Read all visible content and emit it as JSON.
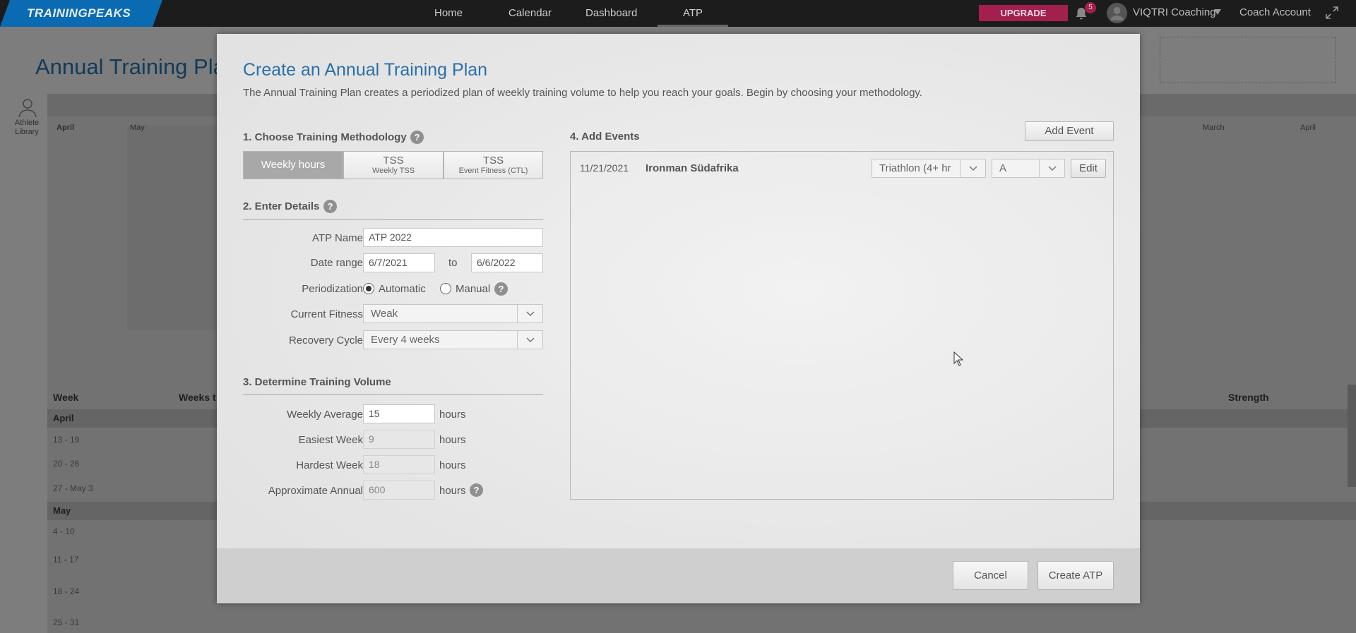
{
  "topbar": {
    "logo": "TRAININGPEAKS",
    "nav": [
      "Home",
      "Calendar",
      "Dashboard",
      "ATP"
    ],
    "upgrade": "UPGRADE",
    "notifications": "5",
    "account": "VIQTRI Coaching",
    "coach_account": "Coach Account"
  },
  "background": {
    "title": "Annual Training Pla",
    "athlete_library": "Athlete Library",
    "months_top": [
      "April",
      "May",
      "March",
      "April"
    ],
    "col_week": "Week",
    "col_weeks_to": "Weeks t",
    "col_strength": "Strength",
    "sections": [
      {
        "month": "April",
        "rows": [
          "13 - 19",
          "20 - 26",
          "27 - May 3"
        ]
      },
      {
        "month": "May",
        "rows": [
          "4 - 10",
          "11 - 17",
          "18 - 24",
          "25 - 31"
        ]
      }
    ]
  },
  "modal": {
    "title": "Create an Annual Training Plan",
    "description": "The Annual Training Plan creates a periodized plan of weekly training volume to help you reach your goals. Begin by choosing your methodology.",
    "section1": "1. Choose Training Methodology",
    "methods": [
      {
        "main": "Weekly hours",
        "sub": ""
      },
      {
        "main": "TSS",
        "sub": "Weekly TSS"
      },
      {
        "main": "TSS",
        "sub": "Event Fitness (CTL)"
      }
    ],
    "section2": "2. Enter Details",
    "atp_name_label": "ATP Name",
    "atp_name": "ATP 2022",
    "date_range_label": "Date range",
    "date_from": "6/7/2021",
    "date_to_label": "to",
    "date_to": "6/6/2022",
    "periodization_label": "Periodization",
    "periodization_auto": "Automatic",
    "periodization_manual": "Manual",
    "current_fitness_label": "Current Fitness",
    "current_fitness": "Weak",
    "recovery_label": "Recovery Cycle",
    "recovery": "Every 4 weeks",
    "section3": "3. Determine Training Volume",
    "weekly_avg_label": "Weekly Average",
    "weekly_avg": "15",
    "easiest_label": "Easiest Week",
    "easiest": "9",
    "hardest_label": "Hardest Week",
    "hardest": "18",
    "annual_label": "Approximate Annual",
    "annual": "600",
    "unit": "hours",
    "section4": "4. Add Events",
    "add_event": "Add Event",
    "event": {
      "date": "11/21/2021",
      "name": "Ironman Südafrika",
      "type": "Triathlon (4+ hr",
      "priority": "A",
      "edit": "Edit"
    },
    "cancel": "Cancel",
    "create": "Create ATP"
  }
}
